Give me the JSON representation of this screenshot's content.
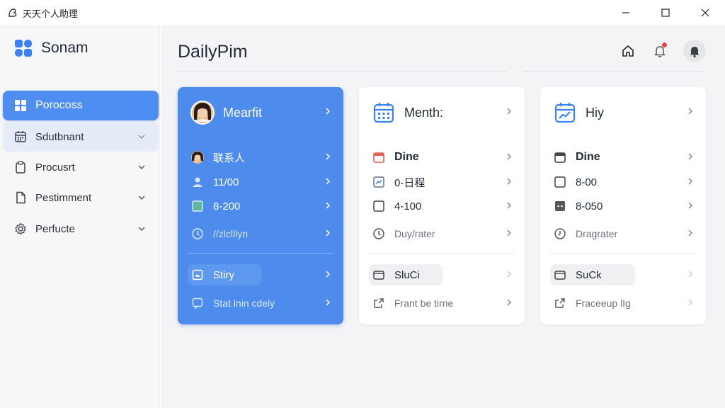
{
  "window": {
    "title": "天天个人助理"
  },
  "sidebar": {
    "brand": "Sonam",
    "items": [
      {
        "label": "Porocoss",
        "icon": "grid-icon"
      },
      {
        "label": "Sdutbnant",
        "icon": "calendar-icon"
      },
      {
        "label": "Procusrt",
        "icon": "clipboard-icon"
      },
      {
        "label": "Pestimment",
        "icon": "document-icon"
      },
      {
        "label": "Perfucte",
        "icon": "gear-icon"
      }
    ]
  },
  "header": {
    "title": "DailyPim"
  },
  "cards": [
    {
      "title": "Mearfit",
      "rows": [
        "联系人",
        "11/00",
        "8-200",
        "//zlclllyn"
      ],
      "footer": [
        "Stiry",
        "Stat lnin cdely"
      ]
    },
    {
      "title": "Menth:",
      "rows": [
        "Dine",
        "0-日程",
        "4-100",
        "Duy/rater"
      ],
      "footer": [
        "SluCi",
        "Frant be tirne"
      ]
    },
    {
      "title": "Hiy",
      "rows": [
        "Dine",
        "8-00",
        "8-050",
        "Dragrater"
      ],
      "footer": [
        "SuCk",
        "Fraceeup lIg"
      ]
    }
  ],
  "colors": {
    "accent": "#4d8ced",
    "notification": "#ef4444",
    "sidebar_bg": "#f7f7f8",
    "main_bg": "#f4f4f6"
  }
}
